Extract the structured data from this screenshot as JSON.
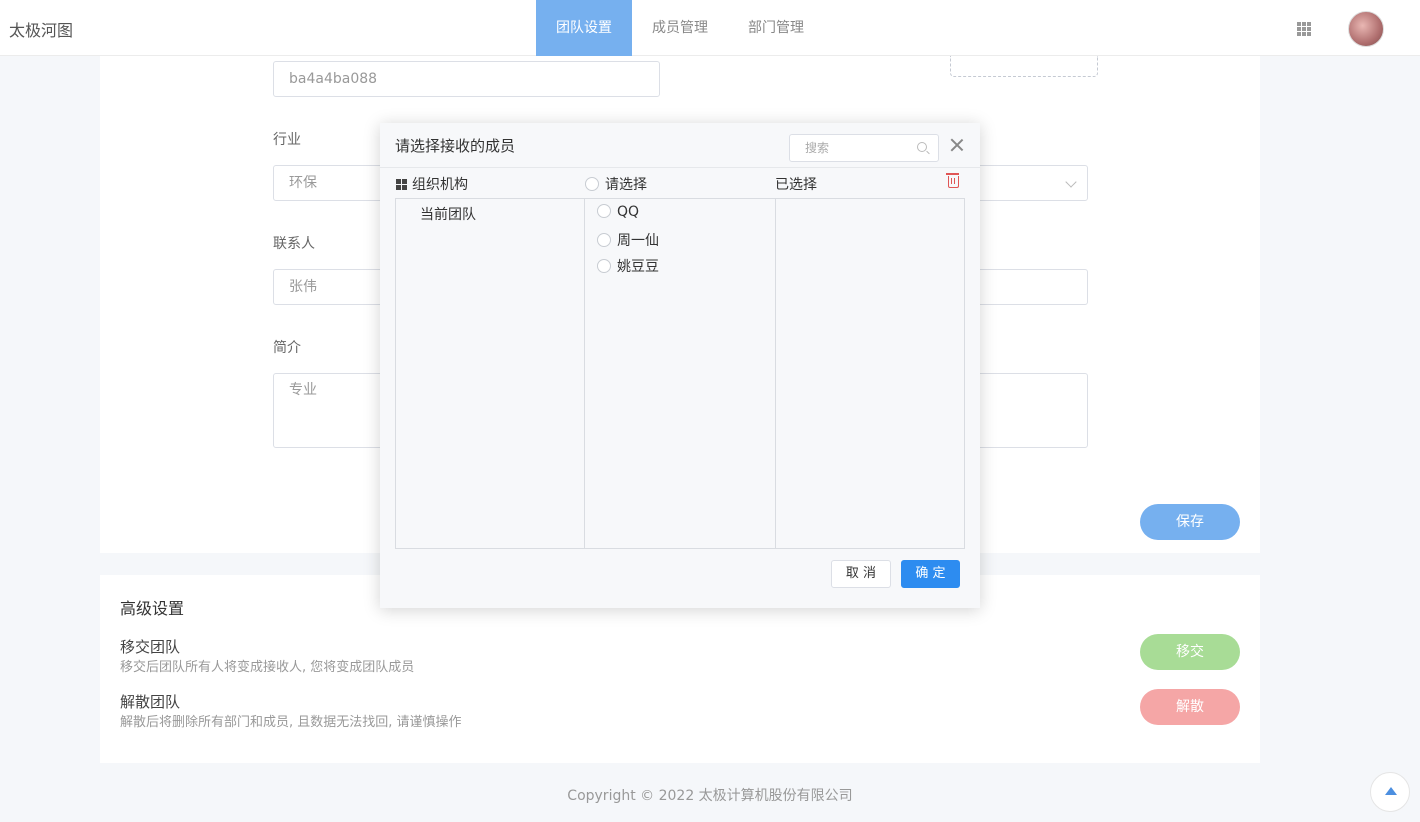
{
  "header": {
    "brand": "太极河图",
    "nav": [
      "团队设置",
      "成员管理",
      "部门管理"
    ],
    "active_nav": 0
  },
  "form": {
    "team_id_value": "ba4a4ba088",
    "industry_label": "行业",
    "industry_value": "环保",
    "contact_label": "联系人",
    "contact_value": "张伟",
    "intro_label": "简介",
    "intro_value": "专业",
    "save_label": "保存"
  },
  "advanced": {
    "title": "高级设置",
    "transfer_title": "移交团队",
    "transfer_desc": "移交后团队所有人将变成接收人, 您将变成团队成员",
    "transfer_button": "移交",
    "dissolve_title": "解散团队",
    "dissolve_desc": "解散后将删除所有部门和成员, 且数据无法找回, 请谨慎操作",
    "dissolve_button": "解散"
  },
  "footer": {
    "copyright": "Copyright © 2022 太极计算机股份有限公司"
  },
  "modal": {
    "title": "请选择接收的成员",
    "search_placeholder": "搜索",
    "col_org": "组织机构",
    "col_select": "请选择",
    "col_selected": "已选择",
    "tree": [
      "当前团队"
    ],
    "members": [
      "QQ",
      "周一仙",
      "姚豆豆"
    ],
    "cancel_label": "取 消",
    "ok_label": "确 定"
  },
  "colors": {
    "nav_active": "#76b0ef",
    "save": "#76b0ef",
    "transfer": "#a8dc96",
    "dissolve": "#f5a6a6",
    "primary": "#2d8cf0",
    "danger": "#e05656"
  }
}
